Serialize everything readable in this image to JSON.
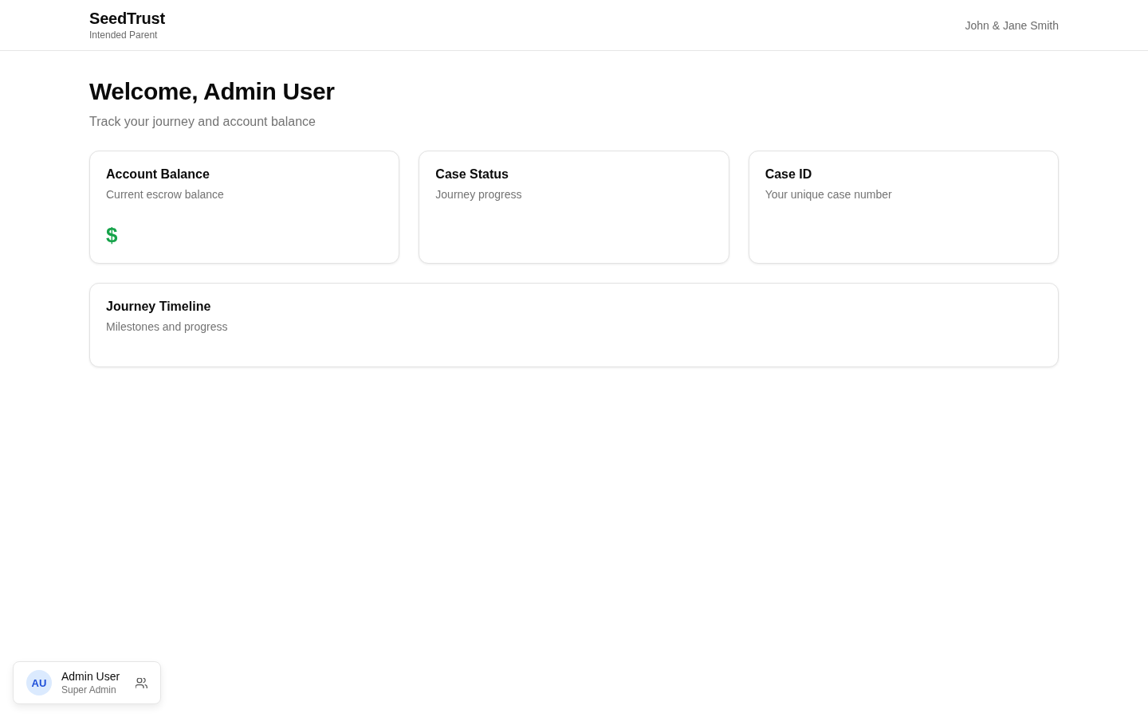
{
  "header": {
    "brand": "SeedTrust",
    "role": "Intended Parent",
    "account_name": "John & Jane Smith"
  },
  "welcome": {
    "title": "Welcome, Admin User",
    "subtitle": "Track your journey and account balance"
  },
  "summary_cards": [
    {
      "kind": "amount",
      "title": "Account Balance",
      "description": "Current escrow balance",
      "value": "$"
    },
    {
      "kind": "plain",
      "title": "Case Status",
      "description": "Journey progress"
    },
    {
      "kind": "plain",
      "title": "Case ID",
      "description": "Your unique case number"
    }
  ],
  "timeline_card": {
    "title": "Journey Timeline",
    "description": "Milestones and progress"
  },
  "user_widget": {
    "initials": "AU",
    "name": "Admin User",
    "role": "Super Admin"
  }
}
